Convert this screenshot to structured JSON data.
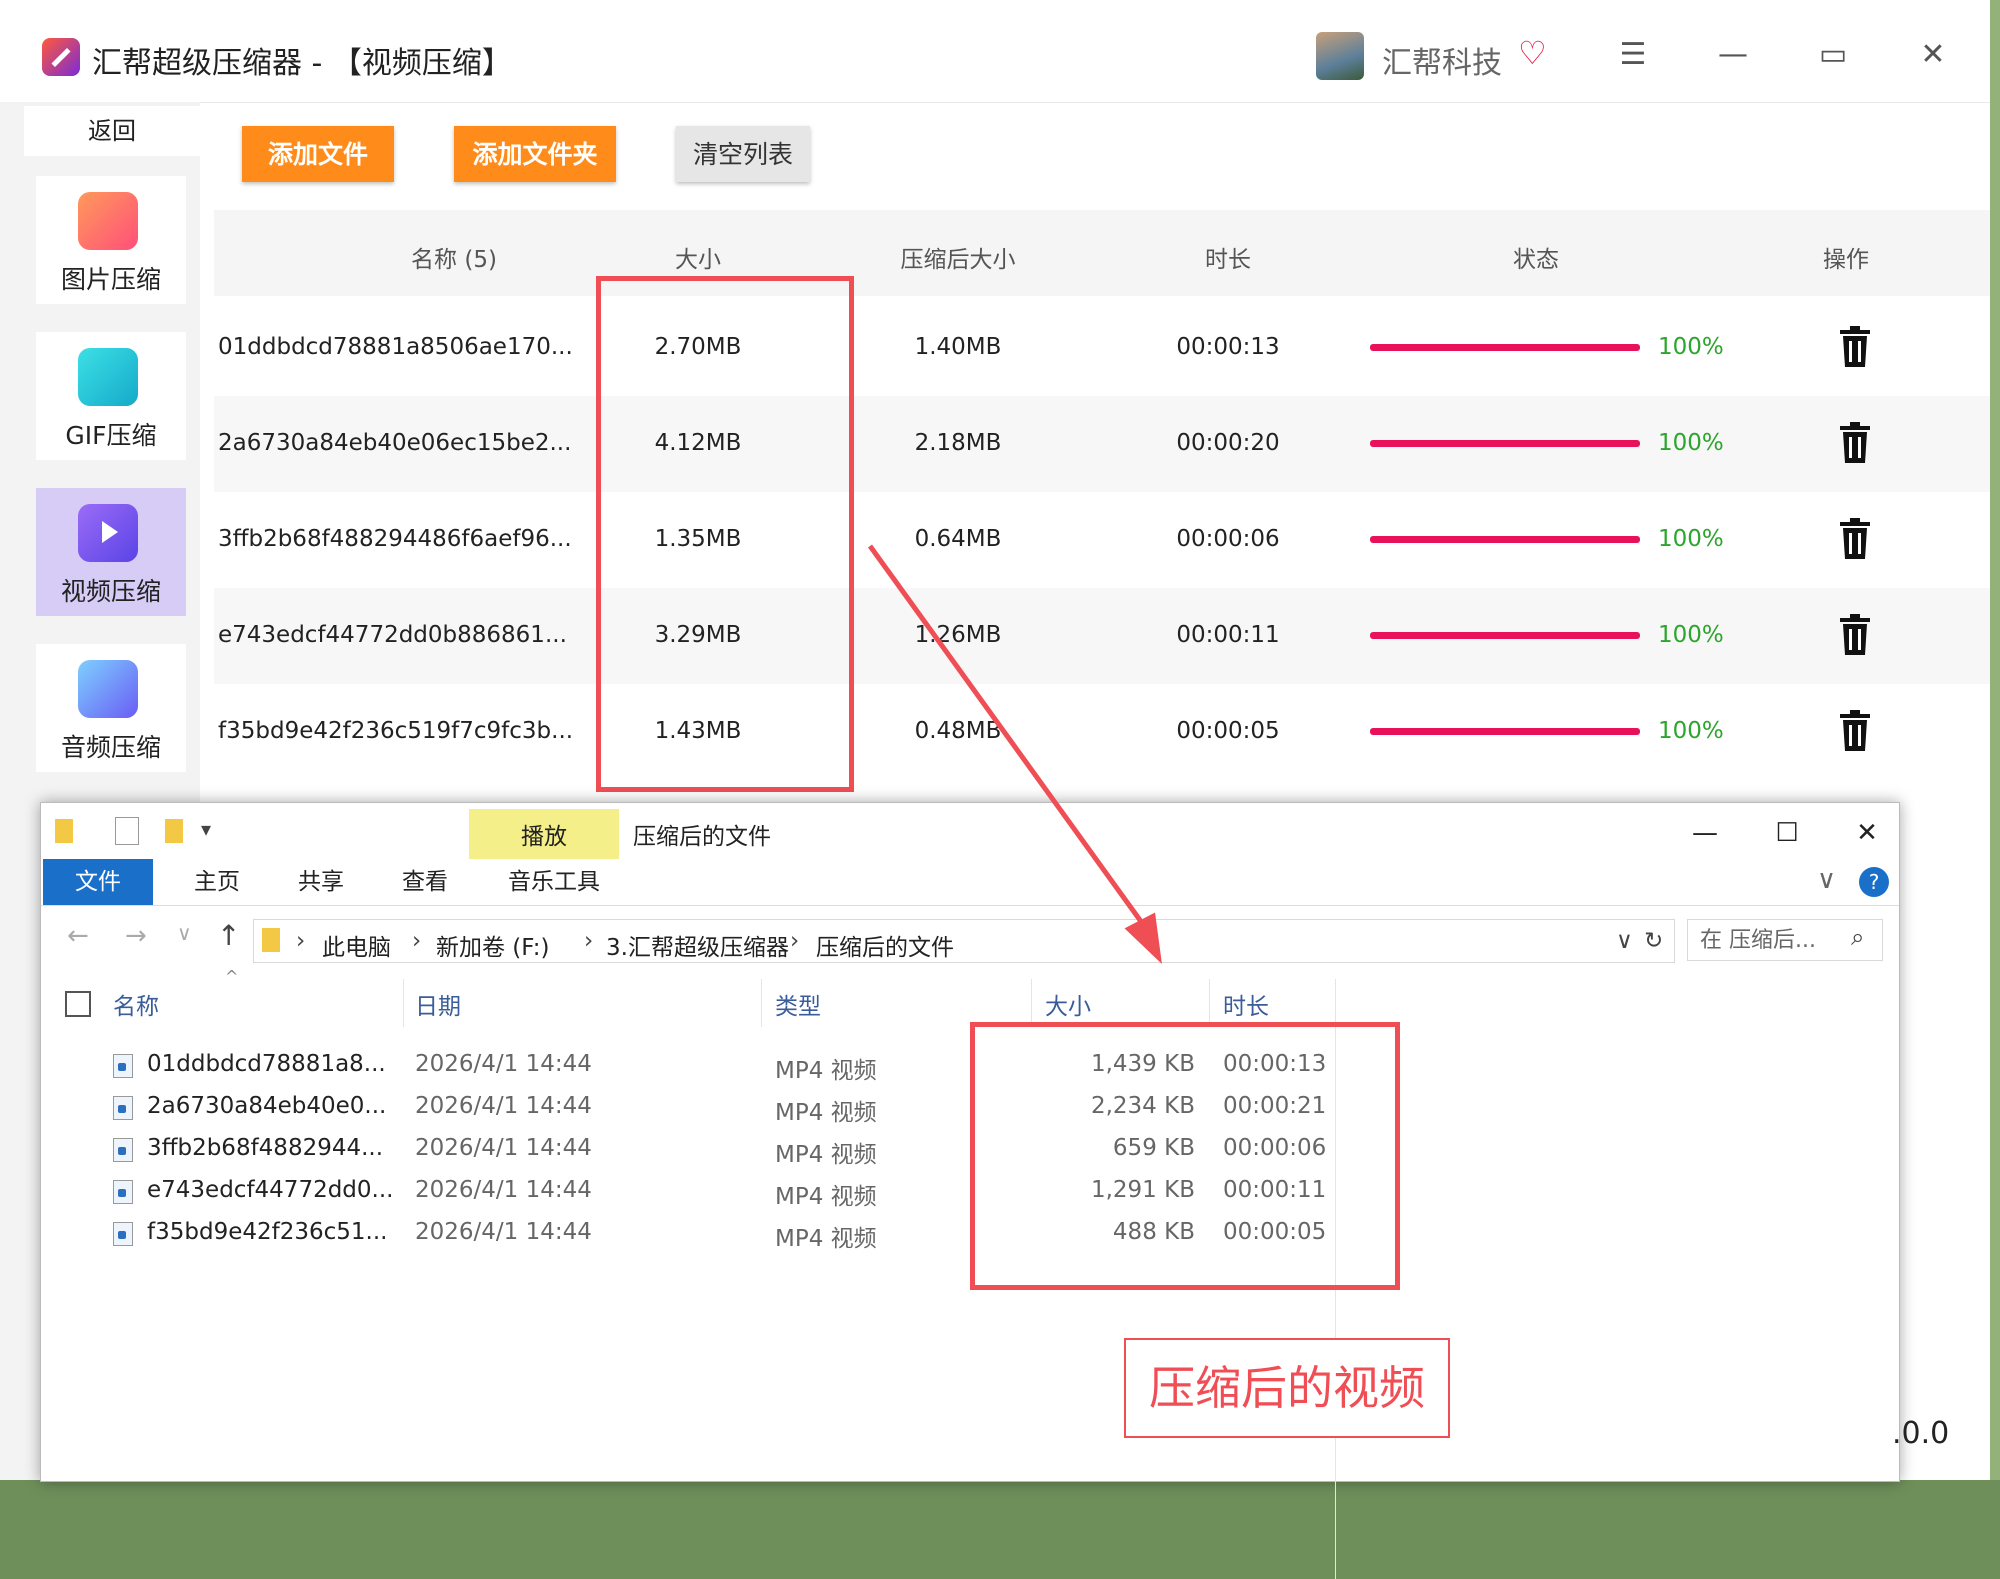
{
  "app": {
    "title": "汇帮超级压缩器  - 【视频压缩】",
    "user": "汇帮科技",
    "version": ".0.0"
  },
  "sidebar": {
    "back_label": "返回",
    "items": [
      {
        "label": "图片压缩",
        "color": "#ff6a6a"
      },
      {
        "label": "GIF压缩",
        "color": "#1ec8d8"
      },
      {
        "label": "视频压缩",
        "color": "#7a5cf0"
      },
      {
        "label": "音频压缩",
        "color": "#5a8cf5"
      }
    ]
  },
  "toolbar": {
    "add_file": "添加文件",
    "add_folder": "添加文件夹",
    "clear_list": "清空列表"
  },
  "table": {
    "headers": [
      "名称 (5)",
      "大小",
      "压缩后大小",
      "时长",
      "状态",
      "操作"
    ],
    "rows": [
      {
        "name": "01ddbdcd78881a8506ae170...",
        "size": "2.70MB",
        "compressed": "1.40MB",
        "duration": "00:00:13",
        "progress": 100,
        "status": "100%"
      },
      {
        "name": "2a6730a84eb40e06ec15be2...",
        "size": "4.12MB",
        "compressed": "2.18MB",
        "duration": "00:00:20",
        "progress": 100,
        "status": "100%"
      },
      {
        "name": "3ffb2b68f488294486f6aef96...",
        "size": "1.35MB",
        "compressed": "0.64MB",
        "duration": "00:00:06",
        "progress": 100,
        "status": "100%"
      },
      {
        "name": "e743edcf44772dd0b886861...",
        "size": "3.29MB",
        "compressed": "1.26MB",
        "duration": "00:00:11",
        "progress": 100,
        "status": "100%"
      },
      {
        "name": "f35bd9e42f236c519f7c9fc3b...",
        "size": "1.43MB",
        "compressed": "0.48MB",
        "duration": "00:00:05",
        "progress": 100,
        "status": "100%"
      }
    ]
  },
  "explorer": {
    "context_tab": "播放",
    "caption": "压缩后的文件",
    "tabs": [
      "文件",
      "主页",
      "共享",
      "查看",
      "音乐工具"
    ],
    "breadcrumbs": [
      "此电脑",
      "新加卷 (F:)",
      "3.汇帮超级压缩器",
      "压缩后的文件"
    ],
    "search_placeholder": "在 压缩后...",
    "columns": [
      "名称",
      "日期",
      "类型",
      "大小",
      "时长"
    ],
    "files": [
      {
        "name": "01ddbdcd78881a8...",
        "date": "2026/4/1 14:44",
        "type": "MP4 视频",
        "size": "1,439 KB",
        "duration": "00:00:13"
      },
      {
        "name": "2a6730a84eb40e0...",
        "date": "2026/4/1 14:44",
        "type": "MP4 视频",
        "size": "2,234 KB",
        "duration": "00:00:21"
      },
      {
        "name": "3ffb2b68f4882944...",
        "date": "2026/4/1 14:44",
        "type": "MP4 视频",
        "size": "659 KB",
        "duration": "00:00:06"
      },
      {
        "name": "e743edcf44772dd0...",
        "date": "2026/4/1 14:44",
        "type": "MP4 视频",
        "size": "1,291 KB",
        "duration": "00:00:11"
      },
      {
        "name": "f35bd9e42f236c51...",
        "date": "2026/4/1 14:44",
        "type": "MP4 视频",
        "size": "488 KB",
        "duration": "00:00:05"
      }
    ]
  },
  "annotation": {
    "label": "压缩后的视频",
    "color": "#ef4e55"
  }
}
